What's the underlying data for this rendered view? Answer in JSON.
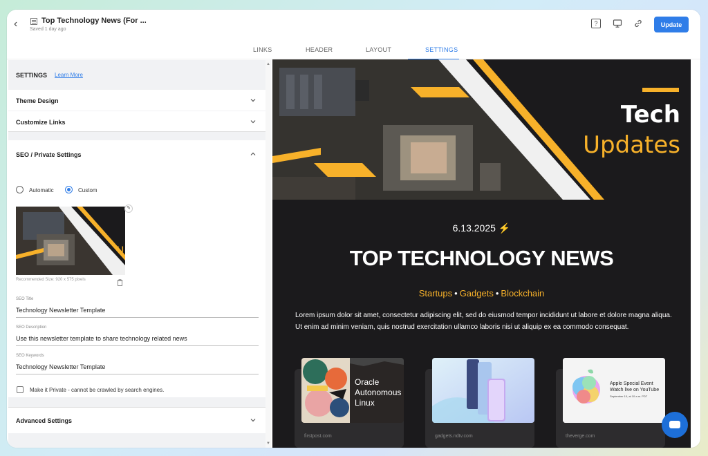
{
  "topbar": {
    "back_label": "‹",
    "doc_title": "Top Technology News (For ...",
    "saved_text": "Saved 1 day ago",
    "help_icon": "?",
    "update_label": "Update"
  },
  "tabs": [
    {
      "label": "LINKS",
      "active": false
    },
    {
      "label": "HEADER",
      "active": false
    },
    {
      "label": "LAYOUT",
      "active": false
    },
    {
      "label": "SETTINGS",
      "active": true
    }
  ],
  "settings": {
    "heading": "SETTINGS",
    "learn_more": "Learn More",
    "sections": {
      "theme_design": "Theme Design",
      "customize_links": "Customize Links",
      "seo_private": "SEO / Private Settings",
      "advanced": "Advanced Settings"
    },
    "mode_options": {
      "automatic": "Automatic",
      "custom": "Custom",
      "selected": "Custom"
    },
    "recommended_size": "Recommended Size: 920 x 575 pixels",
    "seo_title_label": "SEO Title",
    "seo_title_value": "Technology Newsletter Template",
    "seo_description_label": "SEO Description",
    "seo_description_value": "Use this newsletter template to share technology related news",
    "seo_keywords_label": "SEO Keywords",
    "seo_keywords_value": "Technology Newsletter Template",
    "private_label": "Make it Private - cannot be crawled by search engines.",
    "private_checked": false
  },
  "preview": {
    "hero_line1": "Tech",
    "hero_line2": "Updates",
    "date": "6.13.2025",
    "headline": "TOP TECHNOLOGY NEWS",
    "tags": [
      "Startups",
      "Gadgets",
      "Blockchain"
    ],
    "body": "Lorem ipsum dolor sit amet, consectetur adipiscing elit, sed do eiusmod tempor incididunt ut labore et dolore magna aliqua. Ut enim ad minim veniam, quis nostrud exercitation ullamco laboris nisi ut aliquip ex ea commodo consequat.",
    "cards": [
      {
        "source": "firstpost.com",
        "image_text": "Oracle Autonomous Linux"
      },
      {
        "source": "gadgets.ndtv.com",
        "image_text": ""
      },
      {
        "source": "theverge.com",
        "image_text": "Apple Special Event Watch live on YouTube",
        "image_subtext": "September 10, at 10 a.m. PDT"
      }
    ]
  },
  "colors": {
    "accent": "#2f7de8",
    "brand_yellow": "#f7b12a",
    "preview_bg": "#1b1a1c"
  }
}
